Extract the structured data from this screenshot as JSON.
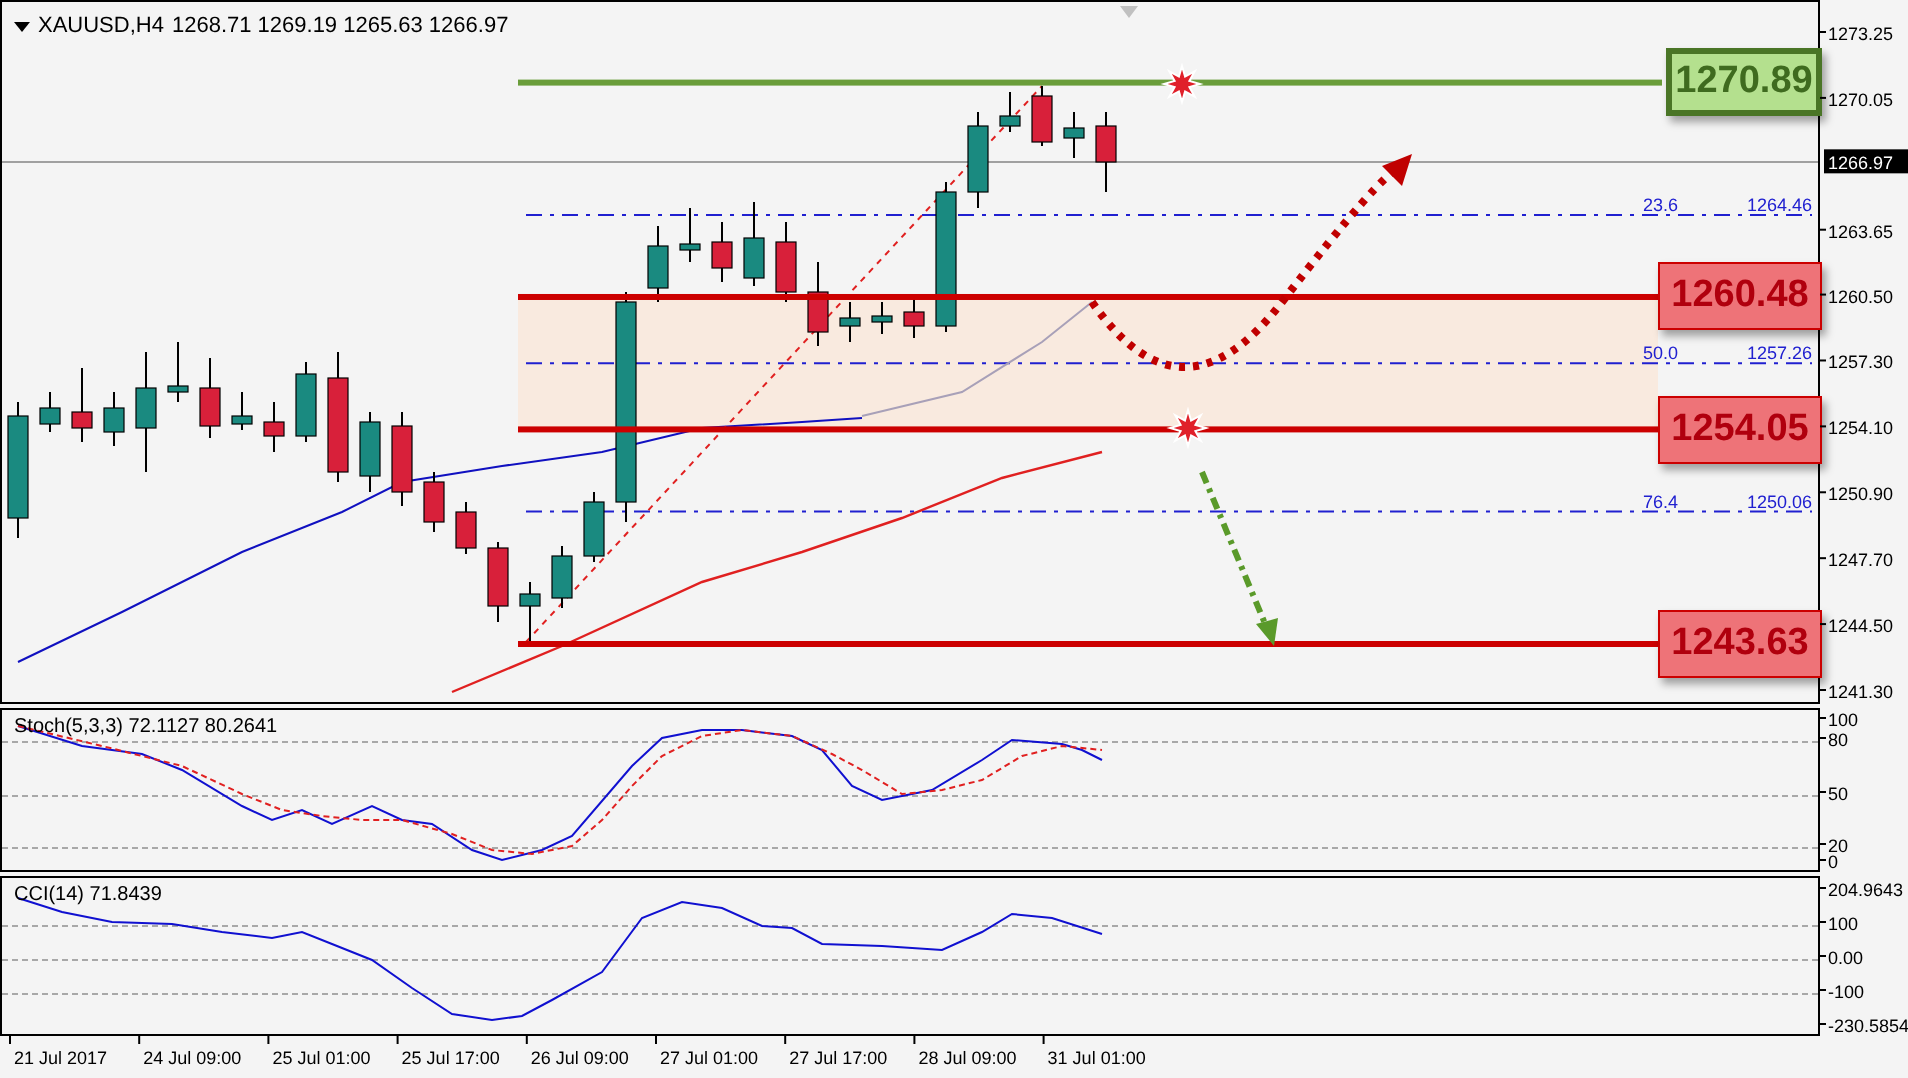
{
  "header": {
    "symbol": "XAUUSD,H4",
    "ohlc": "1268.71 1269.19 1265.63 1266.97"
  },
  "price_axis": {
    "ticks": [
      "1273.25",
      "1270.05",
      "1263.65",
      "1260.50",
      "1257.30",
      "1254.10",
      "1250.90",
      "1247.70",
      "1244.50",
      "1241.30"
    ],
    "current": "1266.97"
  },
  "levels": [
    {
      "label": "1270.89",
      "kind": "target"
    },
    {
      "label": "1260.48",
      "kind": "support"
    },
    {
      "label": "1254.05",
      "kind": "support"
    },
    {
      "label": "1243.63",
      "kind": "support"
    }
  ],
  "fibonacci": [
    {
      "ratio": "23.6",
      "price": "1264.46"
    },
    {
      "ratio": "50.0",
      "price": "1257.26"
    },
    {
      "ratio": "76.4",
      "price": "1250.06"
    }
  ],
  "stochastic": {
    "title": "Stoch(5,3,3) 72.1127 80.2641",
    "ticks": [
      "100",
      "80",
      "50",
      "20",
      "0"
    ]
  },
  "cci": {
    "title": "CCI(14) 71.8439",
    "ticks": [
      "204.9643",
      "100",
      "0.00",
      "-100",
      "-230.5854"
    ]
  },
  "time_axis": [
    "21 Jul 2017",
    "24 Jul 09:00",
    "25 Jul 01:00",
    "25 Jul 17:00",
    "26 Jul 09:00",
    "27 Jul 01:00",
    "27 Jul 17:00",
    "28 Jul 09:00",
    "31 Jul 01:00"
  ]
}
